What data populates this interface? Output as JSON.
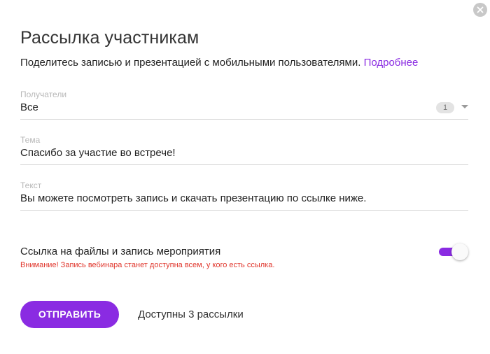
{
  "dialog": {
    "title": "Рассылка участникам",
    "subtitle": "Поделитесь записью и презентацией с мобильными пользователями.",
    "more_link": "Подробнее",
    "close_icon": "close-icon"
  },
  "fields": {
    "recipients": {
      "label": "Получатели",
      "value": "Все",
      "count": "1"
    },
    "subject": {
      "label": "Тема",
      "value": "Спасибо за участие во встрече!"
    },
    "text": {
      "label": "Текст",
      "value": "Вы можете посмотреть запись и скачать презентацию по ссылке ниже."
    }
  },
  "toggle": {
    "label": "Ссылка на файлы и запись мероприятия",
    "warning": "Внимание! Запись вебинара станет доступна всем, у кого есть ссылка.",
    "checked": true
  },
  "footer": {
    "send_label": "ОТПРАВИТЬ",
    "available_text": "Доступны 3 рассылки"
  },
  "colors": {
    "accent": "#8a2be2",
    "warning": "#e0362c",
    "close_bg": "#c8c8c8"
  }
}
